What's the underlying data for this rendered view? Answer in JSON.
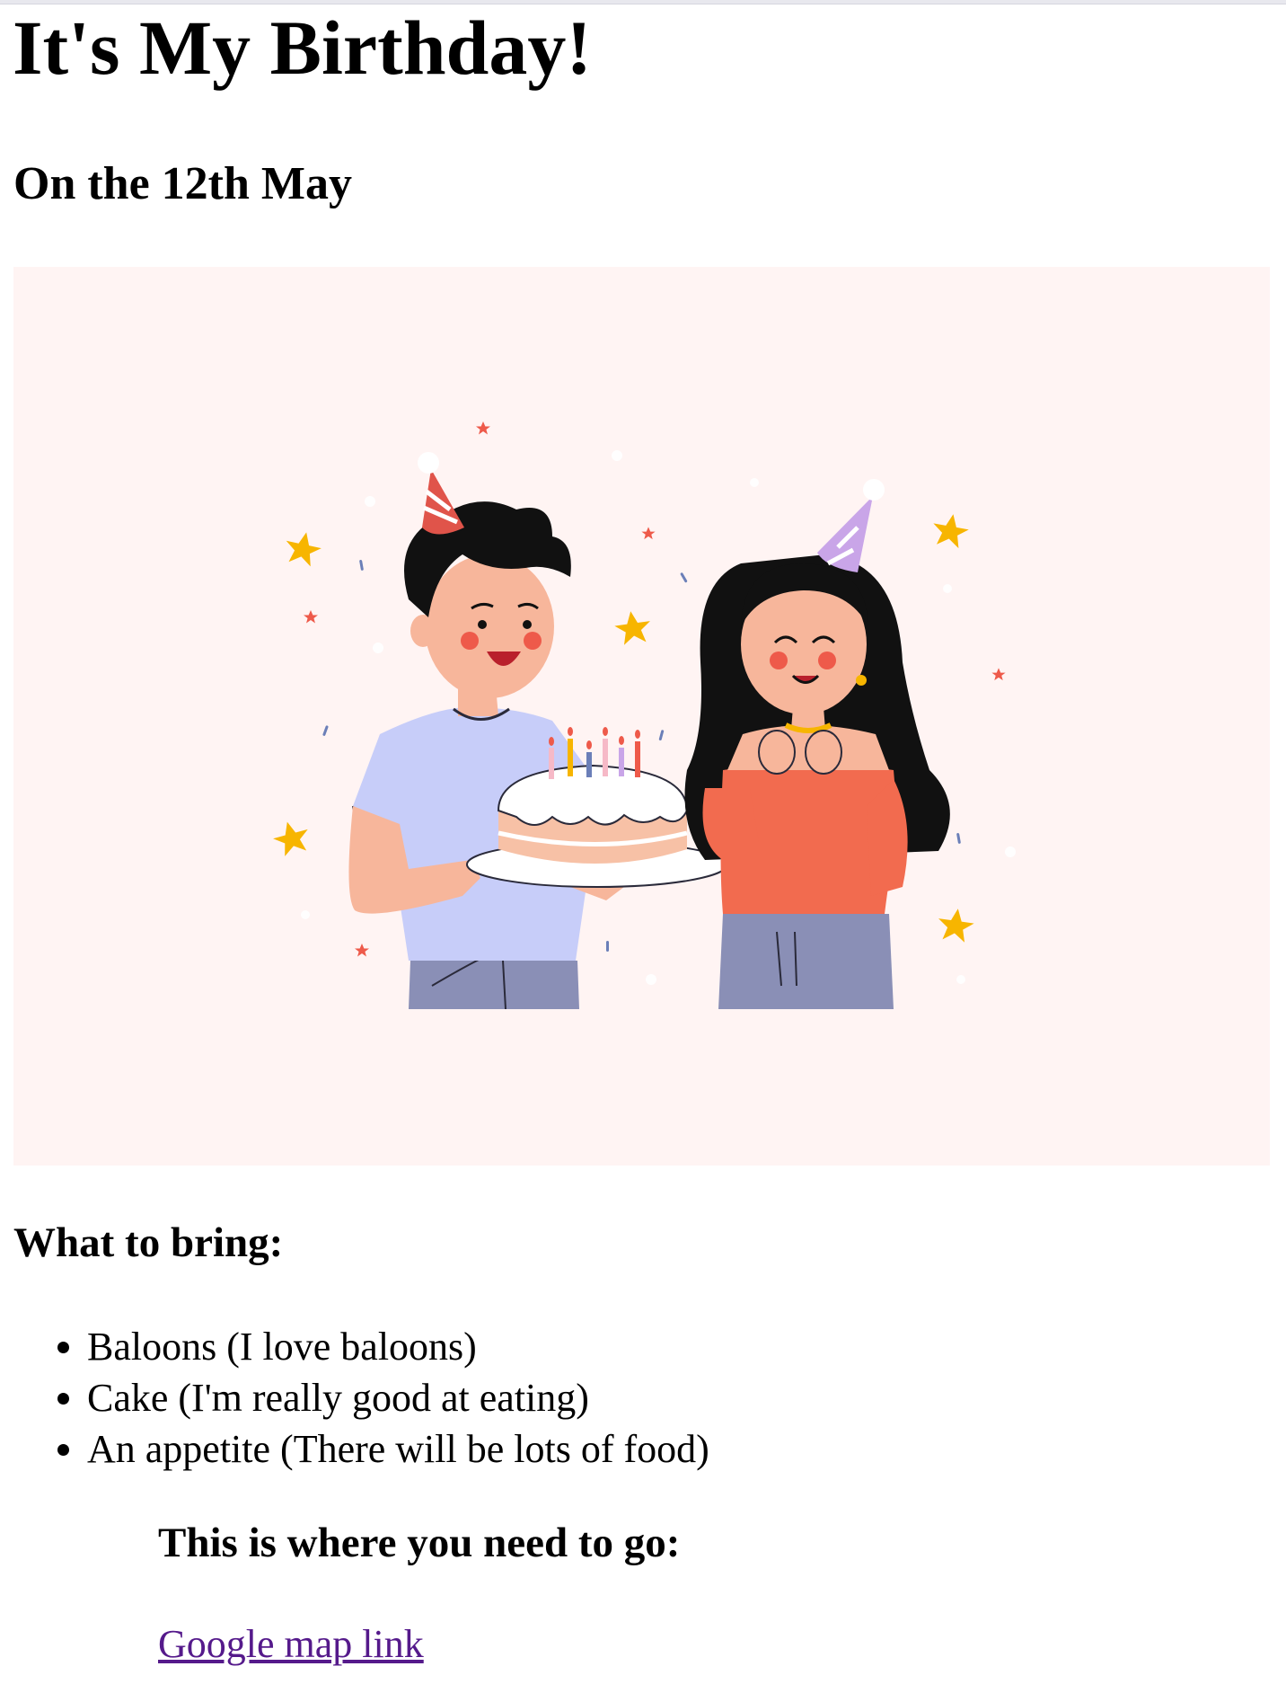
{
  "page": {
    "title": "It's My Birthday!",
    "subtitle": "On the 12th May"
  },
  "hero_image": {
    "icon": "birthday-couple-illustration",
    "background_color": "#fff4f3"
  },
  "bring": {
    "heading": "What to bring:",
    "items": [
      "Baloons (I love baloons)",
      "Cake (I'm really good at eating)",
      "An appetite (There will be lots of food)"
    ]
  },
  "directions": {
    "heading": "This is where you need to go:",
    "link_label": "Google map link",
    "link_color": "#551a8b"
  }
}
